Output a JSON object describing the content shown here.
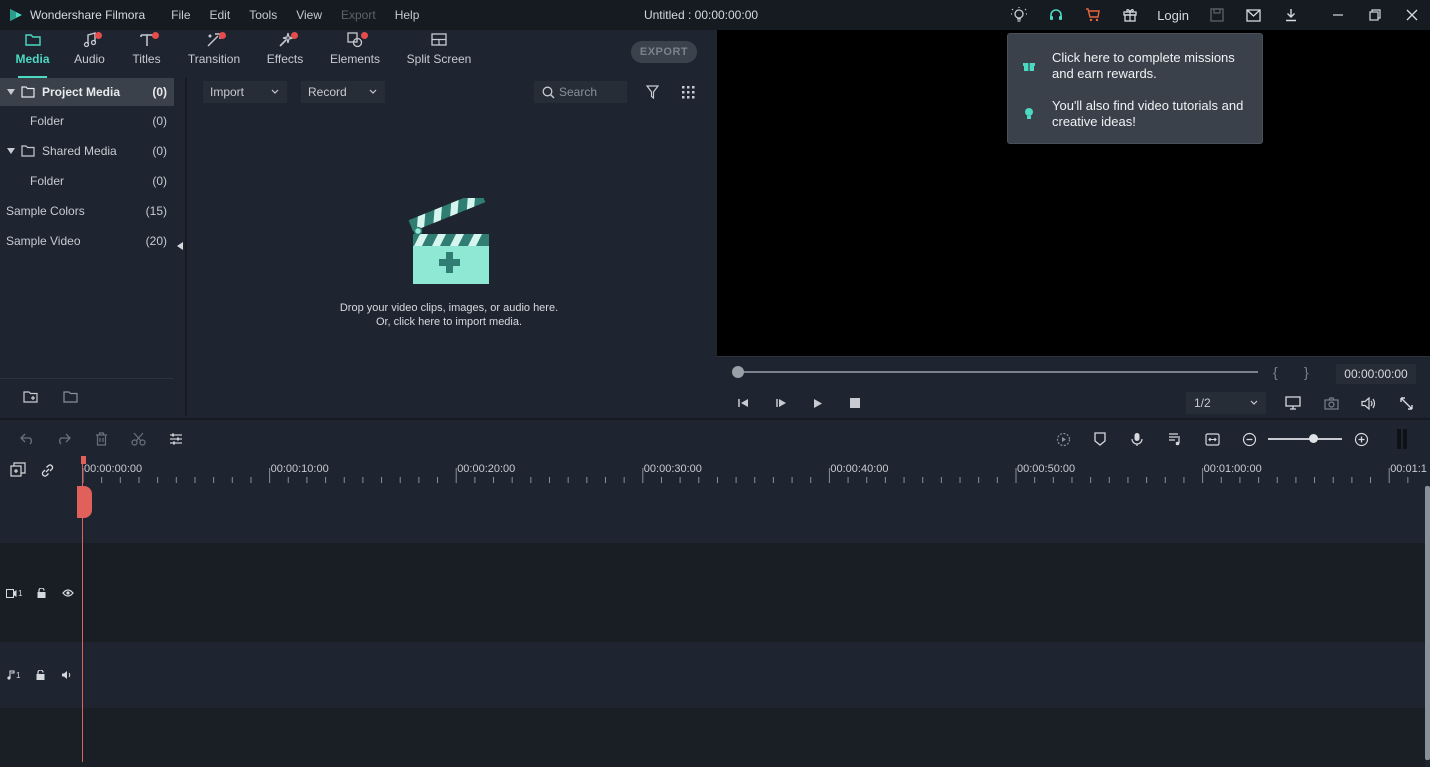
{
  "app": {
    "name": "Wondershare Filmora",
    "document_title": "Untitled : 00:00:00:00",
    "login_label": "Login"
  },
  "menu": [
    "File",
    "Edit",
    "Tools",
    "View",
    "Export",
    "Help"
  ],
  "tabs": [
    {
      "label": "Media",
      "icon": "folder-icon",
      "active": true,
      "badge": false
    },
    {
      "label": "Audio",
      "icon": "music-note-icon",
      "active": false,
      "badge": true
    },
    {
      "label": "Titles",
      "icon": "text-icon",
      "active": false,
      "badge": true
    },
    {
      "label": "Transition",
      "icon": "transition-icon",
      "active": false,
      "badge": true
    },
    {
      "label": "Effects",
      "icon": "effects-icon",
      "active": false,
      "badge": true
    },
    {
      "label": "Elements",
      "icon": "elements-icon",
      "active": false,
      "badge": true
    },
    {
      "label": "Split Screen",
      "icon": "split-screen-icon",
      "active": false,
      "badge": false
    }
  ],
  "export_label": "EXPORT",
  "sidebar": {
    "items": [
      {
        "label": "Project Media",
        "count": "(0)"
      },
      {
        "label": "Folder",
        "count": "(0)"
      },
      {
        "label": "Shared Media",
        "count": "(0)"
      },
      {
        "label": "Folder",
        "count": "(0)"
      },
      {
        "label": "Sample Colors",
        "count": "(15)"
      },
      {
        "label": "Sample Video",
        "count": "(20)"
      }
    ]
  },
  "media": {
    "import_label": "Import",
    "record_label": "Record",
    "search_placeholder": "Search",
    "drop_line1": "Drop your video clips, images, or audio here.",
    "drop_line2": "Or, click here to import media."
  },
  "tooltip": {
    "line1": "Click here to complete missions and earn rewards.",
    "line2": "You'll also find video tutorials and creative ideas!"
  },
  "preview": {
    "timecode": "00:00:00:00",
    "ratio": "1/2",
    "brace_open": "{",
    "brace_close": "}"
  },
  "ruler": {
    "labels": [
      "00:00:00:00",
      "00:00:10:00",
      "00:00:20:00",
      "00:00:30:00",
      "00:00:40:00",
      "00:00:50:00",
      "00:01:00:00",
      "00:01:1"
    ]
  },
  "tracks": {
    "video_label": "1",
    "audio_label": "1"
  },
  "colors": {
    "accent": "#4cd9c2",
    "badge": "#e74c4c",
    "playhead": "#e0615a",
    "cart": "#e8663d"
  }
}
